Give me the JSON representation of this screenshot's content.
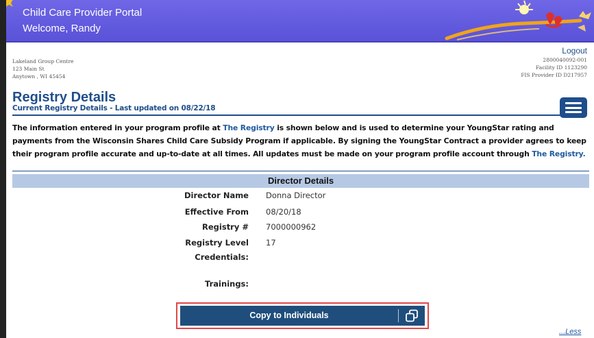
{
  "header": {
    "portal_title": "Child Care Provider Portal",
    "welcome": "Welcome, Randy"
  },
  "address": {
    "line1": "Lakeland Group Centre",
    "line2": "123 Main St",
    "line3": "Anytown , WI 45454"
  },
  "account": {
    "logout": "Logout",
    "provider_number": "2800040092-001",
    "facility_id": "Facility ID 1123290",
    "fis_provider_id": "FIS Provider ID D217957"
  },
  "page": {
    "title": "Registry Details",
    "subtitle": "Current Registry Details - Last updated on 08/22/18"
  },
  "intro": {
    "part1": "The information entered in your program profile at ",
    "link1": "The Registry",
    "part2": " is shown below and is used to determine your YoungStar rating and payments from the Wisconsin Shares Child Care Subsidy Program if applicable. By signing the YoungStar Contract a provider agrees to keep their program profile accurate and up-to-date at all times. All updates must be made on your program profile account through ",
    "link2": "The Registry."
  },
  "director_details": {
    "section_title": "Director Details",
    "rows": [
      {
        "label": "Director Name",
        "value": "Donna Director"
      },
      {
        "label": "Effective From",
        "value": "08/20/18"
      },
      {
        "label": "Registry #",
        "value": "7000000962"
      },
      {
        "label": "Registry Level",
        "value": "17"
      },
      {
        "label": "Credentials:",
        "value": ""
      },
      {
        "label": "Trainings:",
        "value": ""
      }
    ]
  },
  "actions": {
    "copy_button": "Copy to Individuals",
    "less_link": "...Less"
  },
  "colors": {
    "header_bg": "#5a52d8",
    "brand_blue": "#1f4e8c",
    "section_bg": "#b6c9e4",
    "button_bg": "#1f4e7c",
    "highlight_red": "#e0464a"
  }
}
